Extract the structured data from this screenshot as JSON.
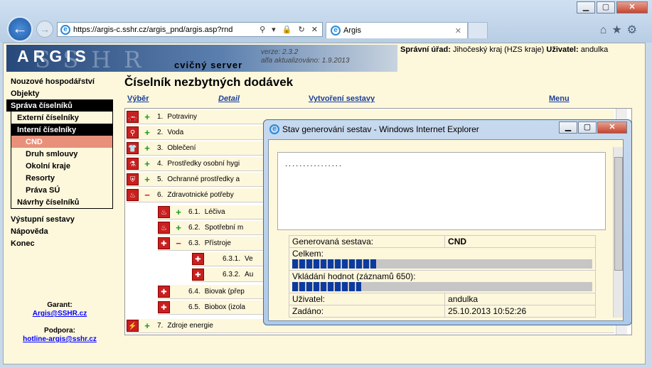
{
  "browser": {
    "url": "https://argis-c.sshr.cz/argis_pnd/argis.asp?rnd",
    "tab_title": "Argis",
    "address_tools": "⚲ ▾ 🔒 ↻ ✕"
  },
  "logo": {
    "argis": "ARGIS",
    "sshr": "SSHR",
    "cvicny": "cvičný server",
    "verze": "verze: 2.3.2",
    "alfa": "alfa aktualizováno: 1.9.2013"
  },
  "header": {
    "urad_label": "Správní úřad:",
    "urad_value": "Jihočeský kraj (HZS kraje)",
    "user_label": "Uživatel:",
    "user_value": "andulka"
  },
  "sidebar": {
    "items": [
      "Nouzové hospodářství",
      "Objekty",
      "Správa číselníků",
      "Externí číselníky",
      "Interní číselníky",
      "CND",
      "Druh smlouvy",
      "Okolní kraje",
      "Resorty",
      "Práva SÚ",
      "Návrhy číselníků",
      "Výstupní sestavy",
      "Nápověda",
      "Konec"
    ],
    "garant_label": "Garant:",
    "garant_email": "Argis@SSHR.cz",
    "podpora_label": "Podpora:",
    "podpora_email": "hotline-argis@sshr.cz"
  },
  "main": {
    "title": "Číselník nezbytných dodávek",
    "menu": [
      "Výběr",
      "Detail",
      "Vytvoření sestavy",
      "Menu"
    ]
  },
  "tree": {
    "rows": [
      {
        "num": "1.",
        "label": "Potraviny",
        "sign": "+",
        "icon": "car-icon"
      },
      {
        "num": "2.",
        "label": "Voda",
        "sign": "+",
        "icon": "tap-icon"
      },
      {
        "num": "3.",
        "label": "Oblečení",
        "sign": "+",
        "icon": "shirt-icon"
      },
      {
        "num": "4.",
        "label": "Prostředky osobní hygi",
        "sign": "+",
        "icon": "hygiene-icon"
      },
      {
        "num": "5.",
        "label": "Ochranné prostředky a",
        "sign": "+",
        "icon": "protection-icon"
      },
      {
        "num": "6.",
        "label": "Zdravotnické potřeby",
        "sign": "−",
        "icon": "medical-icon"
      },
      {
        "num": "6.1.",
        "label": "Léčiva",
        "sign": "+",
        "icon": "medical-icon"
      },
      {
        "num": "6.2.",
        "label": "Spotřební m",
        "sign": "+",
        "icon": "medical-icon"
      },
      {
        "num": "6.3.",
        "label": "Přístroje",
        "sign": "−",
        "icon": "cross-icon"
      },
      {
        "num": "6.3.1.",
        "label": "Ve",
        "sign": "",
        "icon": "cross-icon"
      },
      {
        "num": "6.3.2.",
        "label": "Au",
        "sign": "",
        "icon": "cross-icon"
      },
      {
        "num": "6.4.",
        "label": "Biovak (přep",
        "sign": "",
        "icon": "cross-icon"
      },
      {
        "num": "6.5.",
        "label": "Biobox (izola",
        "sign": "",
        "icon": "cross-icon"
      },
      {
        "num": "7.",
        "label": "Zdroje energie",
        "sign": "+",
        "icon": "energy-icon"
      }
    ]
  },
  "dialog": {
    "title": "Stav generování sestav - Windows Internet Explorer",
    "log": "................",
    "gen_label": "Generovaná sestava:",
    "gen_value": "CND",
    "celkem_label": "Celkem:",
    "celkem_progress": 0.28,
    "vkladani_label": "Vkládání hodnot (záznamů  650):",
    "vkladani_progress": 0.23,
    "user_label": "Uživatel:",
    "user_value": "andulka",
    "zadano_label": "Zadáno:",
    "zadano_value": "25.10.2013 10:52:26"
  }
}
